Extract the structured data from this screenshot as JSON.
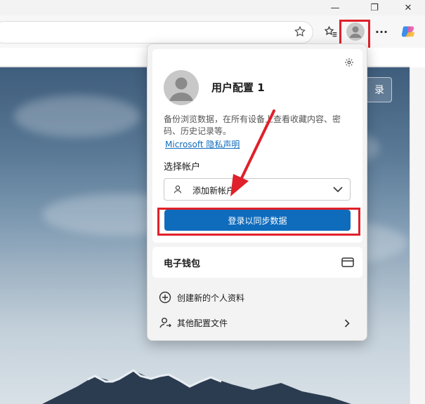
{
  "titlebar": {
    "minimize_glyph": "—",
    "restore_glyph": "❐",
    "close_glyph": "✕"
  },
  "toolbar": {
    "more_glyph": "···"
  },
  "hero": {
    "button_fragment": "录"
  },
  "profile_popup": {
    "profile_name": "用户配置 1",
    "description": "备份浏览数据，在所有设备上查看收藏内容、密码、历史记录等。",
    "privacy_link": "Microsoft 隐私声明",
    "choose_account_label": "选择帐户",
    "add_account_option": "添加新帐户",
    "sync_button": "登录以同步数据",
    "wallet_label": "电子钱包",
    "create_profile": "创建新的个人资料",
    "other_profiles": "其他配置文件"
  },
  "colors": {
    "accent": "#0f6cbd",
    "highlight": "#e0202a"
  }
}
